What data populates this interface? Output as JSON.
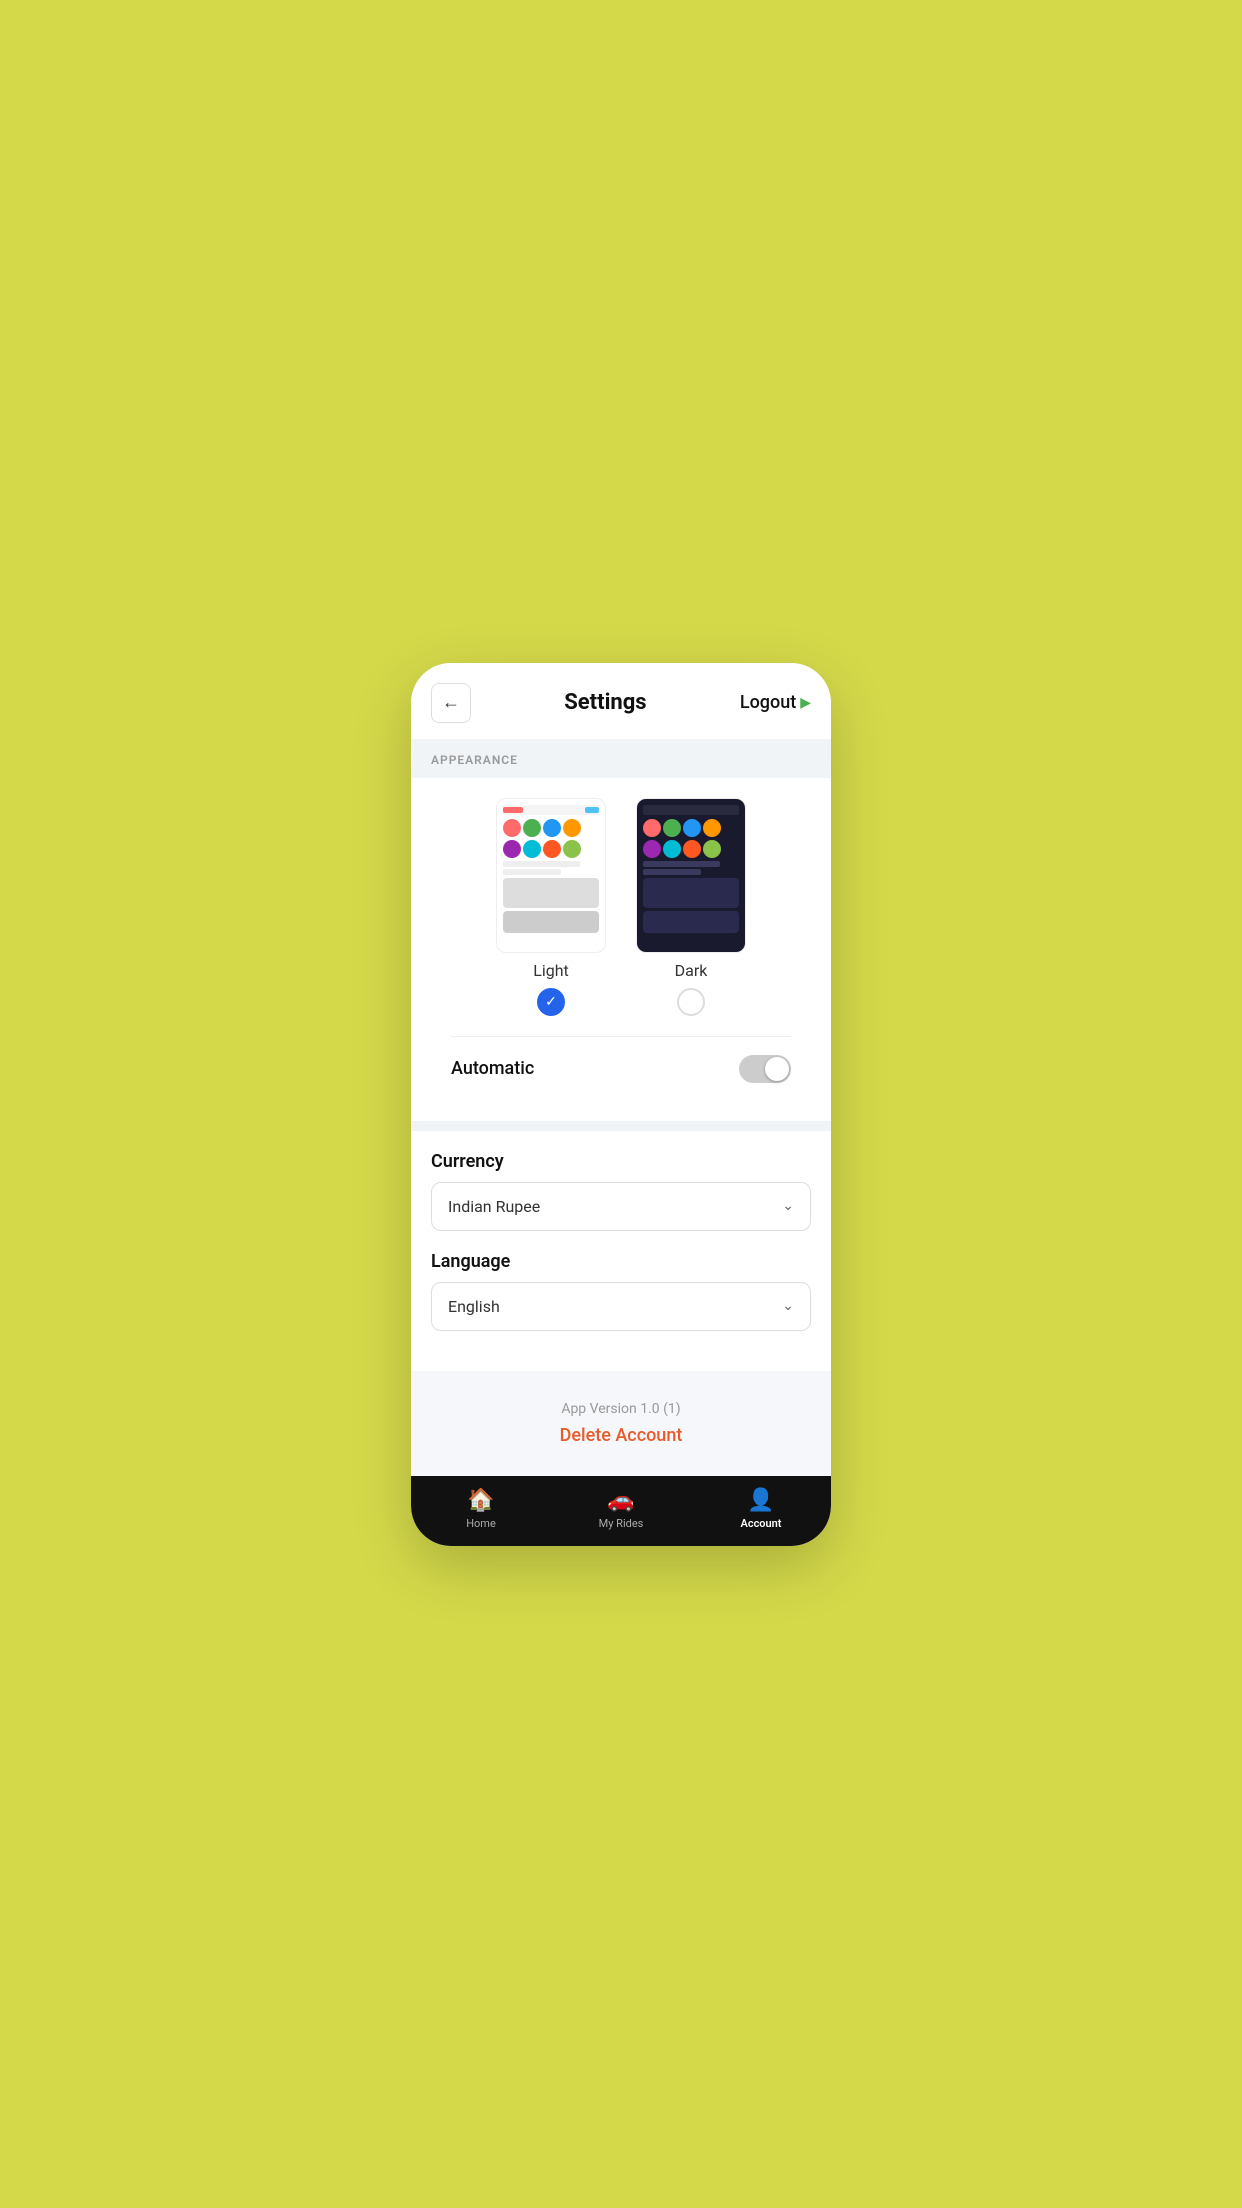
{
  "header": {
    "back_label": "←",
    "title": "Settings",
    "logout_label": "Logout",
    "logout_icon": "▶"
  },
  "appearance": {
    "section_title": "APPEARANCE",
    "light_label": "Light",
    "dark_label": "Dark",
    "light_selected": true,
    "dark_selected": false,
    "automatic_label": "Automatic",
    "automatic_enabled": false
  },
  "currency": {
    "label": "Currency",
    "value": "Indian Rupee",
    "placeholder": "Indian Rupee"
  },
  "language": {
    "label": "Language",
    "value": "English",
    "placeholder": "English"
  },
  "footer": {
    "app_version": "App Version 1.0 (1)",
    "delete_account": "Delete Account"
  },
  "bottom_nav": {
    "home_label": "Home",
    "rides_label": "My Rides",
    "account_label": "Account"
  }
}
